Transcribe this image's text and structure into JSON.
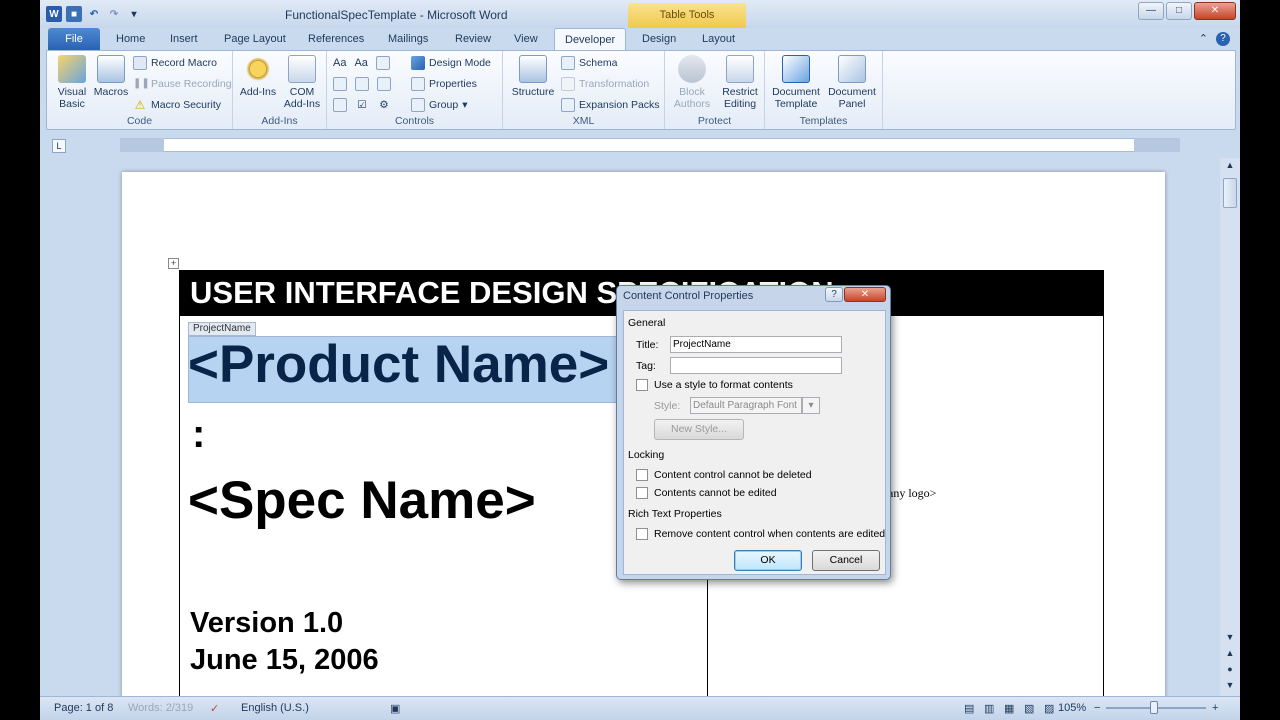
{
  "window": {
    "title": "FunctionalSpecTemplate - Microsoft Word",
    "contextual_tab_group": "Table Tools"
  },
  "tabs": [
    "File",
    "Home",
    "Insert",
    "Page Layout",
    "References",
    "Mailings",
    "Review",
    "View",
    "Developer",
    "Design",
    "Layout"
  ],
  "ribbon": {
    "code": {
      "label": "Code",
      "visual_basic": [
        "Visual",
        "Basic"
      ],
      "macros": "Macros",
      "record_macro": "Record Macro",
      "pause_recording": "Pause Recording",
      "macro_security": "Macro Security"
    },
    "addins": {
      "label": "Add-Ins",
      "addins": "Add-Ins",
      "com_addins": [
        "COM",
        "Add-Ins"
      ]
    },
    "controls": {
      "label": "Controls",
      "design_mode": "Design Mode",
      "properties": "Properties",
      "group": "Group"
    },
    "xml": {
      "label": "XML",
      "structure": "Structure",
      "schema": "Schema",
      "transformation": "Transformation",
      "expansion_packs": "Expansion Packs"
    },
    "protect": {
      "label": "Protect",
      "block_authors": [
        "Block",
        "Authors"
      ],
      "restrict_editing": [
        "Restrict",
        "Editing"
      ]
    },
    "templates": {
      "label": "Templates",
      "document_template": [
        "Document",
        "Template"
      ],
      "document_panel": [
        "Document",
        "Panel"
      ]
    }
  },
  "document": {
    "header": "USER INTERFACE DESIGN SPECIFICATION",
    "content_control_tag": "ProjectName",
    "product_name": "<Product Name>",
    "colon": ":",
    "spec_name": "<Spec Name>",
    "version": "Version 1.0",
    "date": "June 15, 2006",
    "logo_placeholder": "pany logo>"
  },
  "dialog": {
    "title": "Content Control Properties",
    "help": "?",
    "general_label": "General",
    "title_label": "Title:",
    "title_value": "ProjectName",
    "tag_label": "Tag:",
    "tag_value": "",
    "use_style_label": "Use a style to format contents",
    "style_label": "Style:",
    "style_value": "Default Paragraph Font",
    "new_style_label": "New Style...",
    "locking_label": "Locking",
    "cannot_delete_label": "Content control cannot be deleted",
    "cannot_edit_label": "Contents cannot be edited",
    "rich_text_label": "Rich Text Properties",
    "remove_when_edited_label": "Remove content control when contents are edited",
    "ok_label": "OK",
    "cancel_label": "Cancel"
  },
  "statusbar": {
    "page": "Page: 1 of 8",
    "words": "Words: 2/319",
    "language": "English (U.S.)",
    "zoom": "105%"
  },
  "colors": {
    "file_tab": "#2a62b3",
    "table_tools": "#f0c94d",
    "selection": "#b7d3f2",
    "close_button": "#c7432a"
  }
}
